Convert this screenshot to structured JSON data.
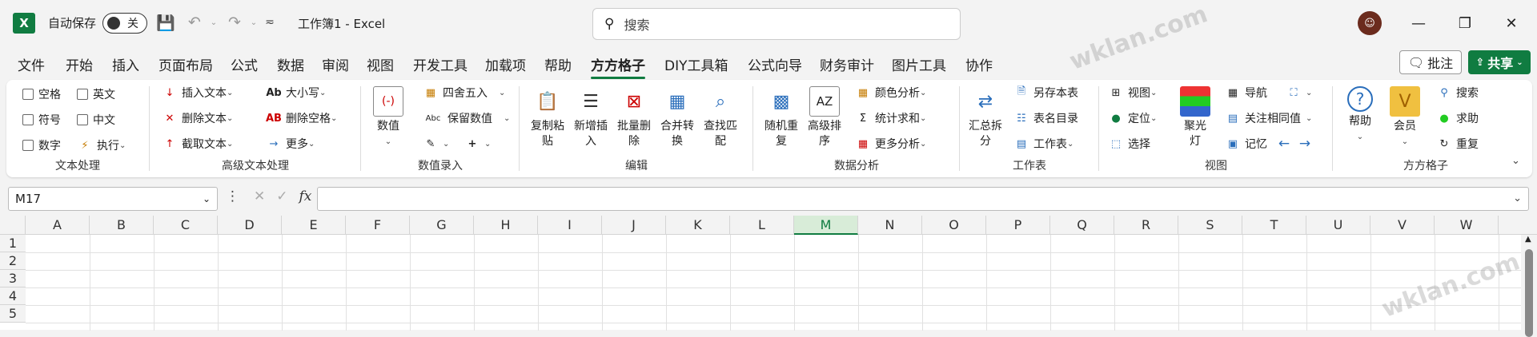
{
  "titlebar": {
    "app_icon": "X",
    "autosave_label": "自动保存",
    "autosave_state": "关",
    "doc_title": "工作簿1 - Excel",
    "search_placeholder": "搜索",
    "avatar": "☺"
  },
  "tabs": [
    "文件",
    "开始",
    "插入",
    "页面布局",
    "公式",
    "数据",
    "审阅",
    "视图",
    "开发工具",
    "加载项",
    "帮助",
    "方方格子",
    "DIY工具箱",
    "公式向导",
    "财务审计",
    "图片工具",
    "协作"
  ],
  "active_tab": "方方格子",
  "actions": {
    "comment": "批注",
    "share": "共享"
  },
  "ribbon": {
    "text_proc": {
      "label": "文本处理",
      "items": [
        "空格",
        "英文",
        "符号",
        "中文",
        "数字",
        "执行"
      ]
    },
    "adv_text": {
      "label": "高级文本处理",
      "items": [
        "插入文本",
        "删除文本",
        "截取文本",
        "大小写",
        "删除空格",
        "更多"
      ]
    },
    "num_entry": {
      "label": "数值录入",
      "big": "数值",
      "items": [
        "四舍五入",
        "保留数值"
      ],
      "abc": "Abc"
    },
    "edit": {
      "label": "编辑",
      "big": [
        "复制粘\n贴",
        "新增插\n入",
        "批量删\n除",
        "合并转\n换",
        "查找匹\n配"
      ]
    },
    "analysis": {
      "label": "数据分析",
      "big": [
        "随机重\n复",
        "高级排\n序"
      ],
      "items": [
        "颜色分析",
        "统计求和",
        "更多分析"
      ]
    },
    "sheet": {
      "label": "工作表",
      "big": "汇总拆\n分",
      "items": [
        "另存本表",
        "表名目录",
        "工作表"
      ]
    },
    "view": {
      "label": "视图",
      "items": [
        "视图",
        "定位",
        "选择",
        "导航",
        "关注相同值",
        "记忆"
      ],
      "big": "聚光\n灯"
    },
    "ffgz": {
      "label": "方方格子",
      "big": [
        "帮助",
        "会员"
      ],
      "items": [
        "搜索",
        "求助",
        "重复"
      ]
    }
  },
  "formula": {
    "name_box": "M17",
    "fx": "fx"
  },
  "grid": {
    "columns": [
      "A",
      "B",
      "C",
      "D",
      "E",
      "F",
      "G",
      "H",
      "I",
      "J",
      "K",
      "L",
      "M",
      "N",
      "O",
      "P",
      "Q",
      "R",
      "S",
      "T",
      "U",
      "V",
      "W"
    ],
    "rows": [
      "1",
      "2",
      "3",
      "4",
      "5"
    ],
    "selected_col": "M"
  },
  "watermark": "wklan.com",
  "colors": {
    "accent": "#107c41"
  }
}
